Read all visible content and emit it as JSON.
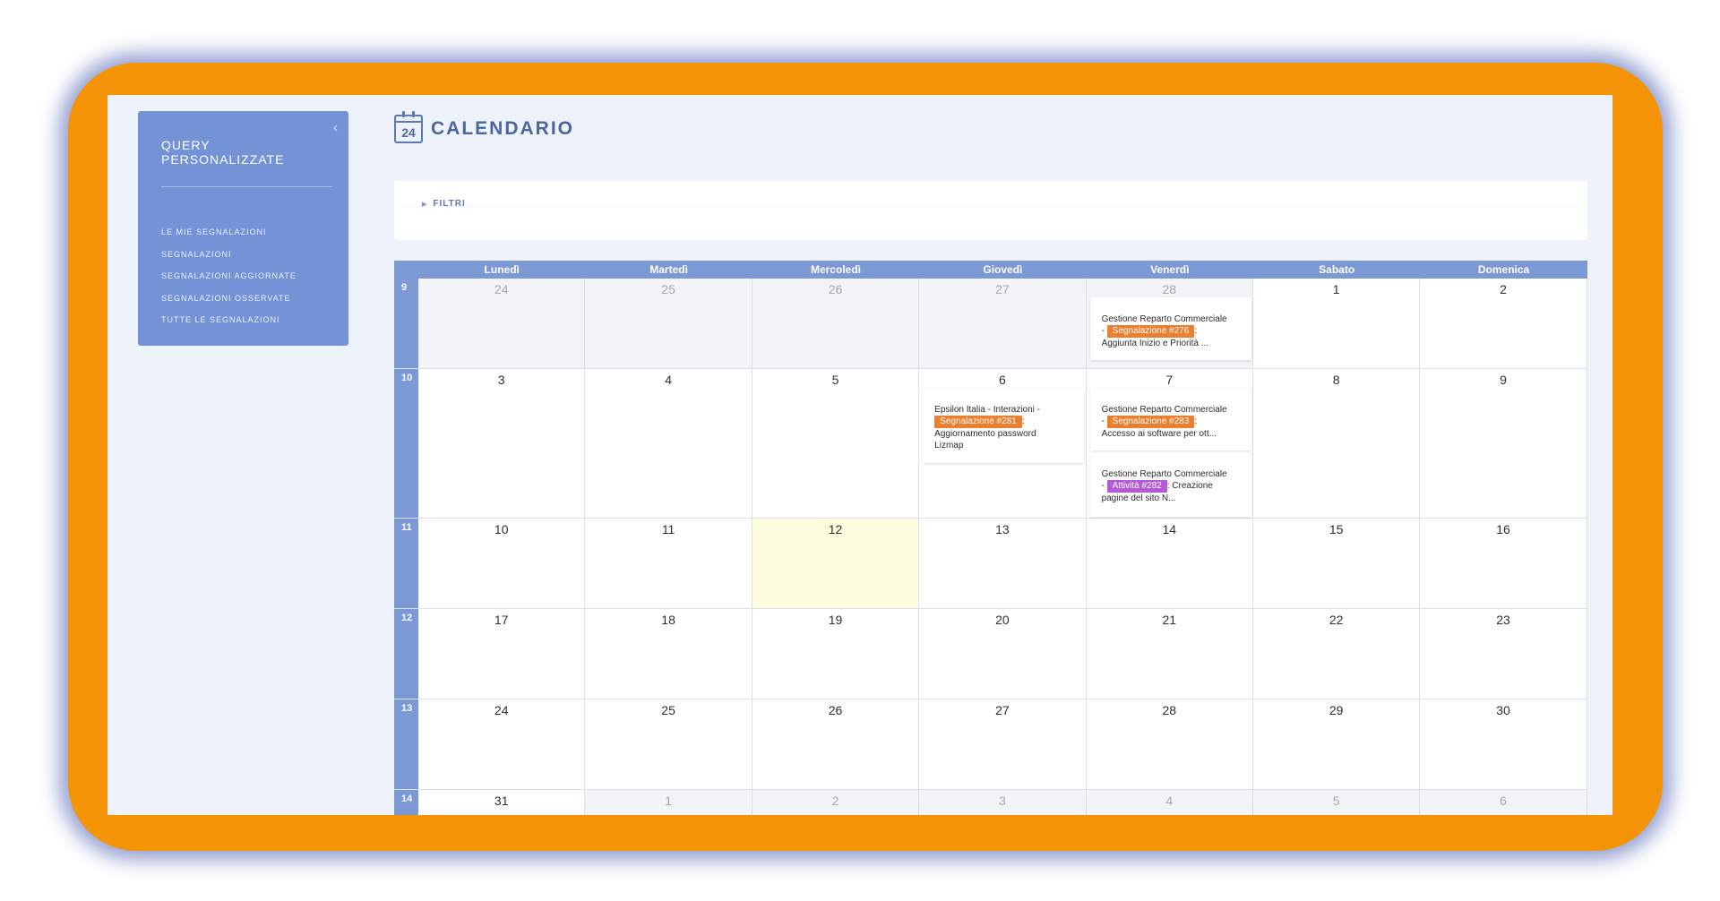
{
  "sidebar": {
    "title": "QUERY PERSONALIZZATE",
    "collapse_icon": "‹",
    "items": [
      "LE MIE SEGNALAZIONI",
      "SEGNALAZIONI",
      "SEGNALAZIONI AGGIORNATE",
      "SEGNALAZIONI OSSERVATE",
      "TUTTE LE SEGNALAZIONI"
    ]
  },
  "header": {
    "icon_day": "24",
    "title": "CALENDARIO"
  },
  "filters": {
    "label": "FILTRI",
    "icon": "▶"
  },
  "calendar": {
    "days": [
      "Lunedì",
      "Martedì",
      "Mercoledì",
      "Giovedì",
      "Venerdì",
      "Sabato",
      "Domenica"
    ],
    "weeks": [
      {
        "number": "9",
        "dates": [
          "24",
          "25",
          "26",
          "27",
          "28",
          "1",
          "2"
        ]
      },
      {
        "number": "10",
        "dates": [
          "3",
          "4",
          "5",
          "6",
          "7",
          "8",
          "9"
        ]
      },
      {
        "number": "11",
        "dates": [
          "10",
          "11",
          "12",
          "13",
          "14",
          "15",
          "16"
        ]
      },
      {
        "number": "12",
        "dates": [
          "17",
          "18",
          "19",
          "20",
          "21",
          "22",
          "23"
        ]
      },
      {
        "number": "13",
        "dates": [
          "24",
          "25",
          "26",
          "27",
          "28",
          "29",
          "30"
        ]
      },
      {
        "number": "14",
        "dates": [
          "31",
          "1",
          "2",
          "3",
          "4",
          "5",
          "6"
        ]
      }
    ],
    "events": [
      {
        "line1": "Gestione Reparto Commerciale",
        "prefix": "- ",
        "badge": "Segnalazione #276",
        "suffix": ":",
        "line3": "Aggiunta Inizio e Priorità ..."
      },
      {
        "line1": "Epsilon Italia - Interazioni -",
        "prefix": "",
        "badge": "Segnalazione #281",
        "suffix": ":",
        "line3": "Aggiornamento password",
        "line4": "Lizmap"
      },
      {
        "line1": "Gestione Reparto Commerciale",
        "prefix": "- ",
        "badge": "Segnalazione #283",
        "suffix": ":",
        "line3": "Accesso ai software per ott..."
      },
      {
        "line1": "Gestione Reparto Commerciale",
        "prefix": "- ",
        "badge": "Attività #282",
        "suffix": ": Creazione",
        "line3": "pagine del sito N..."
      }
    ]
  }
}
